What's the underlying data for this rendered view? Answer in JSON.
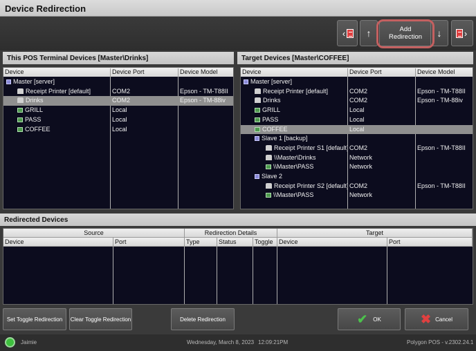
{
  "window": {
    "title": "Device Redirection"
  },
  "toolbar": {
    "add_redirection_line1": "Add",
    "add_redirection_line2": "Redirection",
    "up_glyph": "↑",
    "down_glyph": "↓",
    "left_glyph": "‹",
    "right_glyph": "›"
  },
  "left_panel": {
    "title": "This POS Terminal Devices [Master\\Drinks]",
    "columns": [
      "Device",
      "Device Port",
      "Device Model"
    ],
    "rows": [
      {
        "name": "Master [server]",
        "port": "",
        "model": "",
        "icon": "server-icon",
        "indent": 0,
        "selected": false
      },
      {
        "name": "Receipt Printer [default]",
        "port": "COM2",
        "model": "Epson - TM-T88II",
        "icon": "printer-icon",
        "indent": 1,
        "selected": false
      },
      {
        "name": "Drinks",
        "port": "COM2",
        "model": "Epson - TM-88iv",
        "icon": "printer-icon",
        "indent": 1,
        "selected": true
      },
      {
        "name": "GRILL",
        "port": "Local",
        "model": "",
        "icon": "display-icon",
        "indent": 1,
        "selected": false
      },
      {
        "name": "PASS",
        "port": "Local",
        "model": "",
        "icon": "display-icon",
        "indent": 1,
        "selected": false
      },
      {
        "name": "COFFEE",
        "port": "Local",
        "model": "",
        "icon": "display-icon",
        "indent": 1,
        "selected": false
      }
    ]
  },
  "right_panel": {
    "title": "Target Devices [Master\\COFFEE]",
    "columns": [
      "Device",
      "Device Port",
      "Device Model"
    ],
    "rows": [
      {
        "name": "Master [server]",
        "port": "",
        "model": "",
        "icon": "server-icon",
        "indent": 0,
        "selected": false
      },
      {
        "name": "Receipt Printer [default]",
        "port": "COM2",
        "model": "Epson - TM-T88II",
        "icon": "printer-icon",
        "indent": 1,
        "selected": false
      },
      {
        "name": "Drinks",
        "port": "COM2",
        "model": "Epson - TM-88iv",
        "icon": "printer-icon",
        "indent": 1,
        "selected": false
      },
      {
        "name": "GRILL",
        "port": "Local",
        "model": "",
        "icon": "display-icon",
        "indent": 1,
        "selected": false
      },
      {
        "name": "PASS",
        "port": "Local",
        "model": "",
        "icon": "display-icon",
        "indent": 1,
        "selected": false
      },
      {
        "name": "COFFEE",
        "port": "Local",
        "model": "",
        "icon": "display-icon",
        "indent": 1,
        "selected": true
      },
      {
        "name": "Slave 1 [backup]",
        "port": "",
        "model": "",
        "icon": "server-icon",
        "indent": 1,
        "selected": false
      },
      {
        "name": "Receipt Printer S1 [default]",
        "port": "COM2",
        "model": "Epson - TM-T88II",
        "icon": "printer-icon",
        "indent": 2,
        "selected": false
      },
      {
        "name": "\\\\Master\\Drinks",
        "port": "Network",
        "model": "",
        "icon": "printer-icon",
        "indent": 2,
        "selected": false
      },
      {
        "name": "\\\\Master\\PASS",
        "port": "Network",
        "model": "",
        "icon": "display-icon",
        "indent": 2,
        "selected": false
      },
      {
        "name": "Slave 2",
        "port": "",
        "model": "",
        "icon": "server-icon",
        "indent": 1,
        "selected": false
      },
      {
        "name": "Receipt Printer S2 [default]",
        "port": "COM2",
        "model": "Epson - TM-T88II",
        "icon": "printer-icon",
        "indent": 2,
        "selected": false
      },
      {
        "name": "\\\\Master\\PASS",
        "port": "Network",
        "model": "",
        "icon": "display-icon",
        "indent": 2,
        "selected": false
      }
    ]
  },
  "redirected": {
    "title": "Redirected Devices",
    "group_source": "Source",
    "group_details": "Redirection Details",
    "group_target": "Target",
    "col_device": "Device",
    "col_port": "Port",
    "col_type": "Type",
    "col_status": "Status",
    "col_toggle": "Toggle",
    "col_target_device": "Device",
    "col_target_port": "Port",
    "rows": []
  },
  "buttons": {
    "set_toggle": "Set Toggle Redirection",
    "clear_toggle": "Clear Toggle Redirection",
    "delete": "Delete Redirection",
    "ok": "OK",
    "cancel": "Cancel"
  },
  "status": {
    "user": "Jaimie",
    "date": "Wednesday, March  8, 2023",
    "time": "12:09:21PM",
    "version": "Polygon POS - v.2302.24.1",
    "online_color": "#3ec03e"
  }
}
